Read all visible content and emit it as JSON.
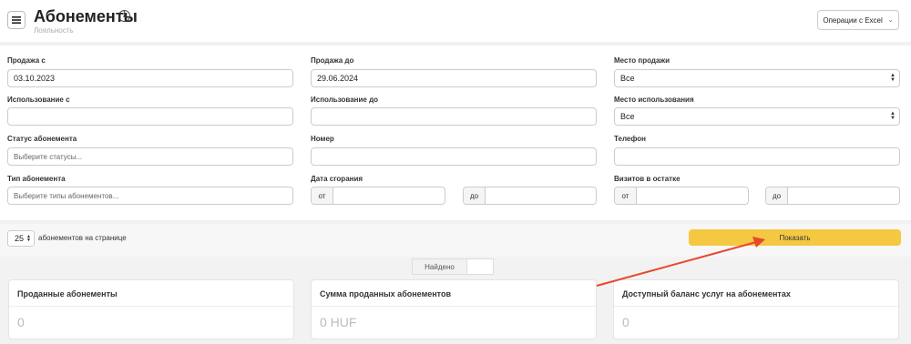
{
  "header": {
    "title": "Абонементы",
    "subtitle": "Лояльность",
    "excel_button": "Операции с Excel",
    "colors": {
      "accent": "#f5c842",
      "annotation_arrow": "#e8482e"
    }
  },
  "filters": {
    "sale_from": {
      "label": "Продажа с",
      "value": "03.10.2023"
    },
    "sale_to": {
      "label": "Продажа до",
      "value": "29.06.2024"
    },
    "sale_place": {
      "label": "Место продажи",
      "value": "Все"
    },
    "use_from": {
      "label": "Использование с",
      "value": ""
    },
    "use_to": {
      "label": "Использование до",
      "value": ""
    },
    "use_place": {
      "label": "Место использования",
      "value": "Все"
    },
    "status": {
      "label": "Статус абонемента",
      "placeholder": "Выберите статусы..."
    },
    "number": {
      "label": "Номер",
      "value": ""
    },
    "phone": {
      "label": "Телефон",
      "value": ""
    },
    "type": {
      "label": "Тип абонемента",
      "placeholder": "Выберите типы абонементов..."
    },
    "expiry": {
      "label": "Дата сгорания",
      "from_prefix": "от",
      "to_prefix": "до"
    },
    "visits_left": {
      "label": "Визитов в остатке",
      "from_prefix": "от",
      "to_prefix": "до"
    }
  },
  "pager": {
    "per_page_value": "25",
    "per_page_label": "абонементов на странице",
    "show_button": "Показать"
  },
  "results": {
    "found_label": "Найдено",
    "found_value": ""
  },
  "cards": [
    {
      "title": "Проданные абонементы",
      "value": "0"
    },
    {
      "title": "Сумма проданных абонементов",
      "value": "0 HUF"
    },
    {
      "title": "Доступный баланс услуг на абонементах",
      "value": "0"
    }
  ]
}
